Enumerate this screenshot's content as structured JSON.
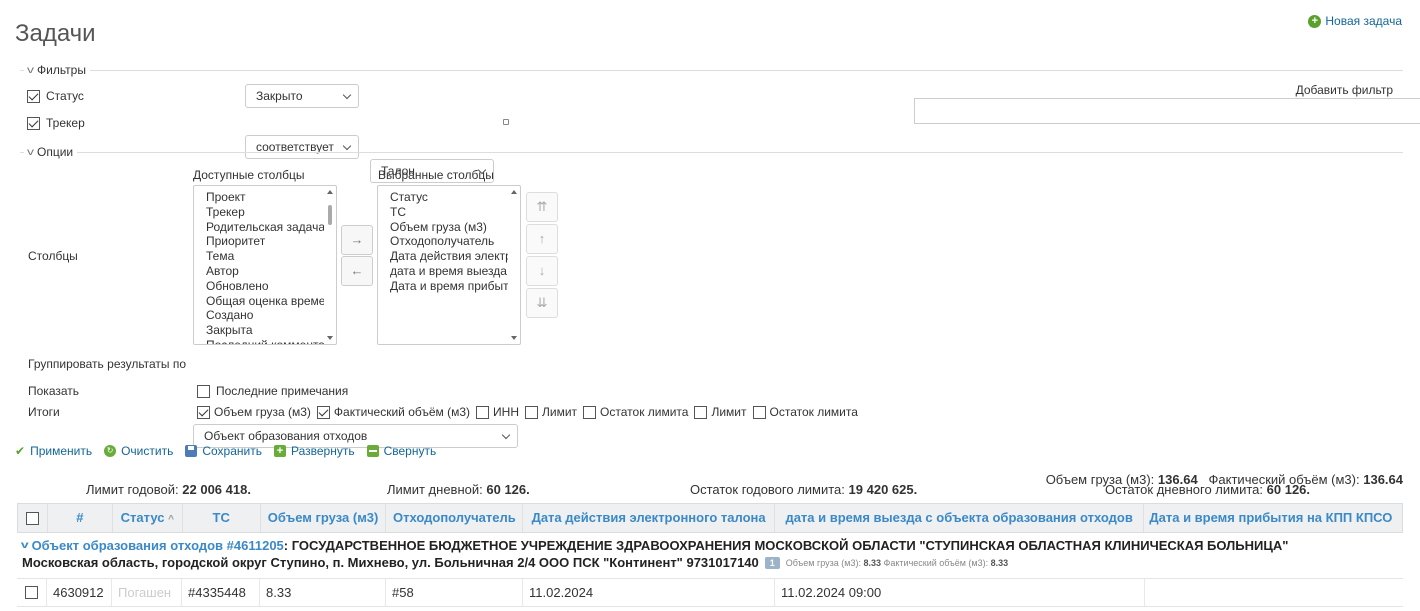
{
  "page": {
    "title": "Задачи",
    "new_task": "Новая задача"
  },
  "filters": {
    "legend": "Фильтры",
    "status": {
      "label": "Статус",
      "operator": "Закрыто"
    },
    "tracker": {
      "label": "Трекер",
      "operator": "соответствует",
      "value": "Талон"
    },
    "add_filter": "Добавить фильтр"
  },
  "options": {
    "legend": "Опции",
    "columns_label": "Столбцы",
    "available_label": "Доступные столбцы",
    "selected_label": "Выбранные столбцы",
    "available": [
      "Проект",
      "Трекер",
      "Родительская задача",
      "Приоритет",
      "Тема",
      "Автор",
      "Обновлено",
      "Общая оценка време",
      "Создано",
      "Закрыта",
      "Последний комментар"
    ],
    "selected": [
      "Статус",
      "ТС",
      "Объем груза (м3)",
      "Отходополучатель",
      "Дата действия электр",
      "дата и время выезда",
      "Дата и время прибыті"
    ],
    "move_right": "→",
    "move_left": "←",
    "move_top": "⇈",
    "move_up": "↑",
    "move_down": "↓",
    "move_bottom": "⇊",
    "group_by_label": "Группировать результаты по",
    "group_by_value": "Объект образования отходов",
    "show_label": "Показать",
    "show_last_notes": "Последние примечания",
    "totals_label": "Итоги",
    "totals": [
      {
        "label": "Объем груза (м3)",
        "checked": true
      },
      {
        "label": "Фактический объём (м3)",
        "checked": true
      },
      {
        "label": "ИНН",
        "checked": false
      },
      {
        "label": "Лимит",
        "checked": false
      },
      {
        "label": "Остаток лимита",
        "checked": false
      },
      {
        "label": "Лимит",
        "checked": false
      },
      {
        "label": "Остаток лимита",
        "checked": false
      }
    ]
  },
  "actions": {
    "apply": "Применить",
    "clear": "Очистить",
    "save": "Сохранить",
    "expand": "Развернуть",
    "collapse": "Свернуть"
  },
  "limits": {
    "year_label": "Лимит годовой:",
    "year_value": "22 006 418.",
    "day_label": "Лимит дневной:",
    "day_value": "60 126.",
    "year_rest_label": "Остаток годового лимита:",
    "year_rest_value": "19 420 625.",
    "day_rest_label": "Остаток дневного лимита:",
    "day_rest_value": "60 126."
  },
  "totals_summary": {
    "volume_label": "Объем груза (м3):",
    "volume_value": "136.64",
    "actual_label": "Фактический объём (м3):",
    "actual_value": "136.64"
  },
  "table": {
    "headers": [
      "#",
      "Статус",
      "ТС",
      "Объем груза (м3)",
      "Отходополучатель",
      "Дата действия электронного талона",
      "дата и время выезда с объекта образования отходов",
      "Дата и время прибытия на КПП КПСО"
    ],
    "sort_indicator": "^",
    "group": {
      "link": "Объект образования отходов #4611205",
      "name": ": ГОСУДАРСТВЕННОЕ БЮДЖЕТНОЕ УЧРЕЖДЕНИЕ ЗДРАВООХРАНЕНИЯ МОСКОВСКОЙ ОБЛАСТИ \"СТУПИНСКАЯ ОБЛАСТНАЯ КЛИНИЧЕСКАЯ БОЛЬНИЦА\"",
      "address": "Московская область, городской округ Ступино, п. Михнево, ул. Больничная 2/4 ООО ПСК \"Континент\" 9731017140",
      "count": "1",
      "vol_label": "Объем груза (м3):",
      "vol_value": "8.33",
      "act_label": "Фактический объём (м3):",
      "act_value": "8.33"
    },
    "rows": [
      {
        "id": "4630912",
        "status": "Погашен",
        "ts": "#4335448",
        "volume": "8.33",
        "receiver": "#58",
        "valid_date": "11.02.2024",
        "departure": "11.02.2024 09:00",
        "arrival": ""
      }
    ]
  }
}
